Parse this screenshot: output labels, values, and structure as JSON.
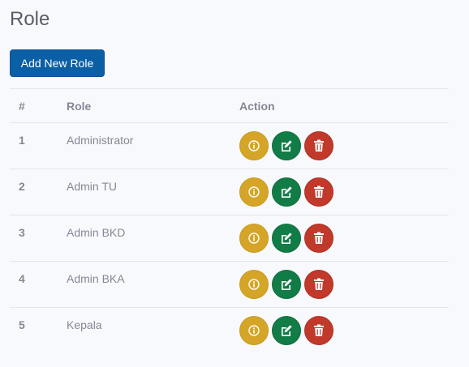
{
  "page": {
    "title": "Role"
  },
  "toolbar": {
    "add_label": "Add New Role"
  },
  "table": {
    "headers": [
      "#",
      "Role",
      "Action"
    ],
    "rows": [
      {
        "num": "1",
        "role": "Administrator"
      },
      {
        "num": "2",
        "role": "Admin TU"
      },
      {
        "num": "3",
        "role": "Admin BKD"
      },
      {
        "num": "4",
        "role": "Admin BKA"
      },
      {
        "num": "5",
        "role": "Kepala"
      }
    ],
    "action_icons": [
      "info-icon",
      "edit-icon",
      "trash-icon"
    ]
  },
  "colors": {
    "primary": "#0b5fa5",
    "info": "#d4a526",
    "edit": "#127c46",
    "delete": "#c0392b"
  }
}
